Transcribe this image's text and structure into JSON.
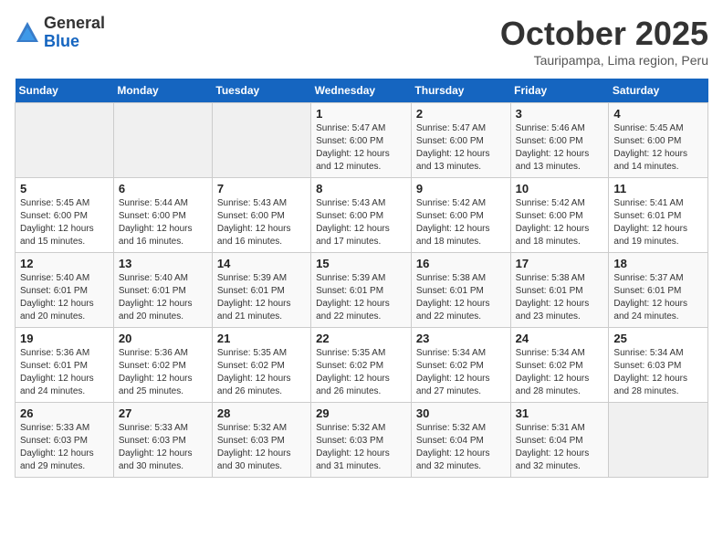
{
  "header": {
    "logo_general": "General",
    "logo_blue": "Blue",
    "month_title": "October 2025",
    "subtitle": "Tauripampa, Lima region, Peru"
  },
  "weekdays": [
    "Sunday",
    "Monday",
    "Tuesday",
    "Wednesday",
    "Thursday",
    "Friday",
    "Saturday"
  ],
  "weeks": [
    [
      {
        "day": "",
        "info": ""
      },
      {
        "day": "",
        "info": ""
      },
      {
        "day": "",
        "info": ""
      },
      {
        "day": "1",
        "info": "Sunrise: 5:47 AM\nSunset: 6:00 PM\nDaylight: 12 hours\nand 12 minutes."
      },
      {
        "day": "2",
        "info": "Sunrise: 5:47 AM\nSunset: 6:00 PM\nDaylight: 12 hours\nand 13 minutes."
      },
      {
        "day": "3",
        "info": "Sunrise: 5:46 AM\nSunset: 6:00 PM\nDaylight: 12 hours\nand 13 minutes."
      },
      {
        "day": "4",
        "info": "Sunrise: 5:45 AM\nSunset: 6:00 PM\nDaylight: 12 hours\nand 14 minutes."
      }
    ],
    [
      {
        "day": "5",
        "info": "Sunrise: 5:45 AM\nSunset: 6:00 PM\nDaylight: 12 hours\nand 15 minutes."
      },
      {
        "day": "6",
        "info": "Sunrise: 5:44 AM\nSunset: 6:00 PM\nDaylight: 12 hours\nand 16 minutes."
      },
      {
        "day": "7",
        "info": "Sunrise: 5:43 AM\nSunset: 6:00 PM\nDaylight: 12 hours\nand 16 minutes."
      },
      {
        "day": "8",
        "info": "Sunrise: 5:43 AM\nSunset: 6:00 PM\nDaylight: 12 hours\nand 17 minutes."
      },
      {
        "day": "9",
        "info": "Sunrise: 5:42 AM\nSunset: 6:00 PM\nDaylight: 12 hours\nand 18 minutes."
      },
      {
        "day": "10",
        "info": "Sunrise: 5:42 AM\nSunset: 6:00 PM\nDaylight: 12 hours\nand 18 minutes."
      },
      {
        "day": "11",
        "info": "Sunrise: 5:41 AM\nSunset: 6:01 PM\nDaylight: 12 hours\nand 19 minutes."
      }
    ],
    [
      {
        "day": "12",
        "info": "Sunrise: 5:40 AM\nSunset: 6:01 PM\nDaylight: 12 hours\nand 20 minutes."
      },
      {
        "day": "13",
        "info": "Sunrise: 5:40 AM\nSunset: 6:01 PM\nDaylight: 12 hours\nand 20 minutes."
      },
      {
        "day": "14",
        "info": "Sunrise: 5:39 AM\nSunset: 6:01 PM\nDaylight: 12 hours\nand 21 minutes."
      },
      {
        "day": "15",
        "info": "Sunrise: 5:39 AM\nSunset: 6:01 PM\nDaylight: 12 hours\nand 22 minutes."
      },
      {
        "day": "16",
        "info": "Sunrise: 5:38 AM\nSunset: 6:01 PM\nDaylight: 12 hours\nand 22 minutes."
      },
      {
        "day": "17",
        "info": "Sunrise: 5:38 AM\nSunset: 6:01 PM\nDaylight: 12 hours\nand 23 minutes."
      },
      {
        "day": "18",
        "info": "Sunrise: 5:37 AM\nSunset: 6:01 PM\nDaylight: 12 hours\nand 24 minutes."
      }
    ],
    [
      {
        "day": "19",
        "info": "Sunrise: 5:36 AM\nSunset: 6:01 PM\nDaylight: 12 hours\nand 24 minutes."
      },
      {
        "day": "20",
        "info": "Sunrise: 5:36 AM\nSunset: 6:02 PM\nDaylight: 12 hours\nand 25 minutes."
      },
      {
        "day": "21",
        "info": "Sunrise: 5:35 AM\nSunset: 6:02 PM\nDaylight: 12 hours\nand 26 minutes."
      },
      {
        "day": "22",
        "info": "Sunrise: 5:35 AM\nSunset: 6:02 PM\nDaylight: 12 hours\nand 26 minutes."
      },
      {
        "day": "23",
        "info": "Sunrise: 5:34 AM\nSunset: 6:02 PM\nDaylight: 12 hours\nand 27 minutes."
      },
      {
        "day": "24",
        "info": "Sunrise: 5:34 AM\nSunset: 6:02 PM\nDaylight: 12 hours\nand 28 minutes."
      },
      {
        "day": "25",
        "info": "Sunrise: 5:34 AM\nSunset: 6:03 PM\nDaylight: 12 hours\nand 28 minutes."
      }
    ],
    [
      {
        "day": "26",
        "info": "Sunrise: 5:33 AM\nSunset: 6:03 PM\nDaylight: 12 hours\nand 29 minutes."
      },
      {
        "day": "27",
        "info": "Sunrise: 5:33 AM\nSunset: 6:03 PM\nDaylight: 12 hours\nand 30 minutes."
      },
      {
        "day": "28",
        "info": "Sunrise: 5:32 AM\nSunset: 6:03 PM\nDaylight: 12 hours\nand 30 minutes."
      },
      {
        "day": "29",
        "info": "Sunrise: 5:32 AM\nSunset: 6:03 PM\nDaylight: 12 hours\nand 31 minutes."
      },
      {
        "day": "30",
        "info": "Sunrise: 5:32 AM\nSunset: 6:04 PM\nDaylight: 12 hours\nand 32 minutes."
      },
      {
        "day": "31",
        "info": "Sunrise: 5:31 AM\nSunset: 6:04 PM\nDaylight: 12 hours\nand 32 minutes."
      },
      {
        "day": "",
        "info": ""
      }
    ]
  ]
}
